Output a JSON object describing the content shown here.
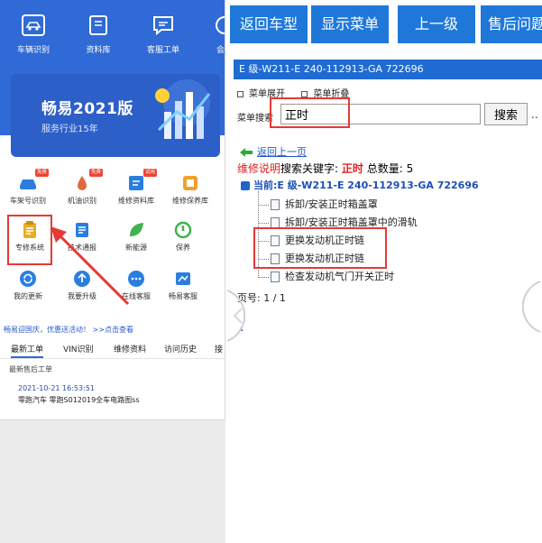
{
  "left": {
    "nav": [
      {
        "label": "车辆识别",
        "icon": "car-scan-icon"
      },
      {
        "label": "资料库",
        "icon": "book-icon"
      },
      {
        "label": "客服工单",
        "icon": "chat-icon"
      },
      {
        "label": "会员",
        "icon": "member-icon"
      }
    ],
    "banner": {
      "title": "畅易2021版",
      "subtitle": "服务行业15年"
    },
    "grid": [
      {
        "label": "车架号识别",
        "badge": "免费",
        "icon": "vin-icon",
        "color": "#2a7ee0"
      },
      {
        "label": "机油识别",
        "badge": "免费",
        "icon": "oil-icon",
        "color": "#e2683a"
      },
      {
        "label": "维修资料库",
        "badge": "试用",
        "icon": "repair-data-icon",
        "color": "#2a7ee0"
      },
      {
        "label": "维修保养库",
        "badge": "",
        "icon": "maintenance-icon",
        "color": "#f0a030"
      },
      {
        "label": "专修系统",
        "badge": "",
        "icon": "clipboard-icon",
        "color": "#e8b020"
      },
      {
        "label": "技术通报",
        "badge": "",
        "icon": "bulletin-icon",
        "color": "#2a7ee0"
      },
      {
        "label": "新能源",
        "badge": "",
        "icon": "new-energy-icon",
        "color": "#3fb34f"
      },
      {
        "label": "保养",
        "badge": "",
        "icon": "care-icon",
        "color": "#3fb34f"
      },
      {
        "label": "我的更新",
        "badge": "",
        "icon": "update-icon",
        "color": "#2a7ee0"
      },
      {
        "label": "我要升级",
        "badge": "",
        "icon": "upgrade-icon",
        "color": "#2a7ee0"
      },
      {
        "label": "在线客服",
        "badge": "",
        "icon": "service-icon",
        "color": "#2a7ee0"
      },
      {
        "label": "畅易客服",
        "badge": "",
        "icon": "support-icon",
        "color": "#2a7ee0"
      }
    ],
    "promo": "畅易迎国庆，优惠送活动！ >>点击查看",
    "tabs": [
      "最新工单",
      "VIN识别",
      "维修资料",
      "访问历史",
      "接"
    ],
    "list_sub": "最新售后工单",
    "item_time": "2021-10-21 16:53:51",
    "item_title": "零跑汽车 零跑S012019全车电路图ss"
  },
  "right": {
    "toolbar": [
      "返回车型",
      "显示菜单",
      "上一级",
      "售后问题"
    ],
    "path": "E 级-W211-E 240-112913-GA 722696",
    "menu_expand": "菜单展开",
    "menu_collapse": "菜单折叠",
    "search_label": "菜单搜索",
    "search_value": "正时",
    "search_button": "搜索",
    "more": "..",
    "back_link": "返回上一页",
    "info": {
      "prefix": "维修说明",
      "mid": "搜索关键字:",
      "keyword": "正时",
      "count_label": "总数量:",
      "count": "5"
    },
    "current": "当前:E 级-W211-E 240-112913-GA 722696",
    "results": [
      "拆卸/安装正时箱盖罩",
      "拆卸/安装正时箱盖罩中的滑轨",
      "更换发动机正时链",
      "更换发动机正时链",
      "检查发动机气门开关正时"
    ],
    "page": "页号: 1 / 1"
  },
  "colors": {
    "brand_blue": "#2f6ad6",
    "toolbar_blue": "#1f78d9",
    "highlight_red": "#e53935"
  }
}
